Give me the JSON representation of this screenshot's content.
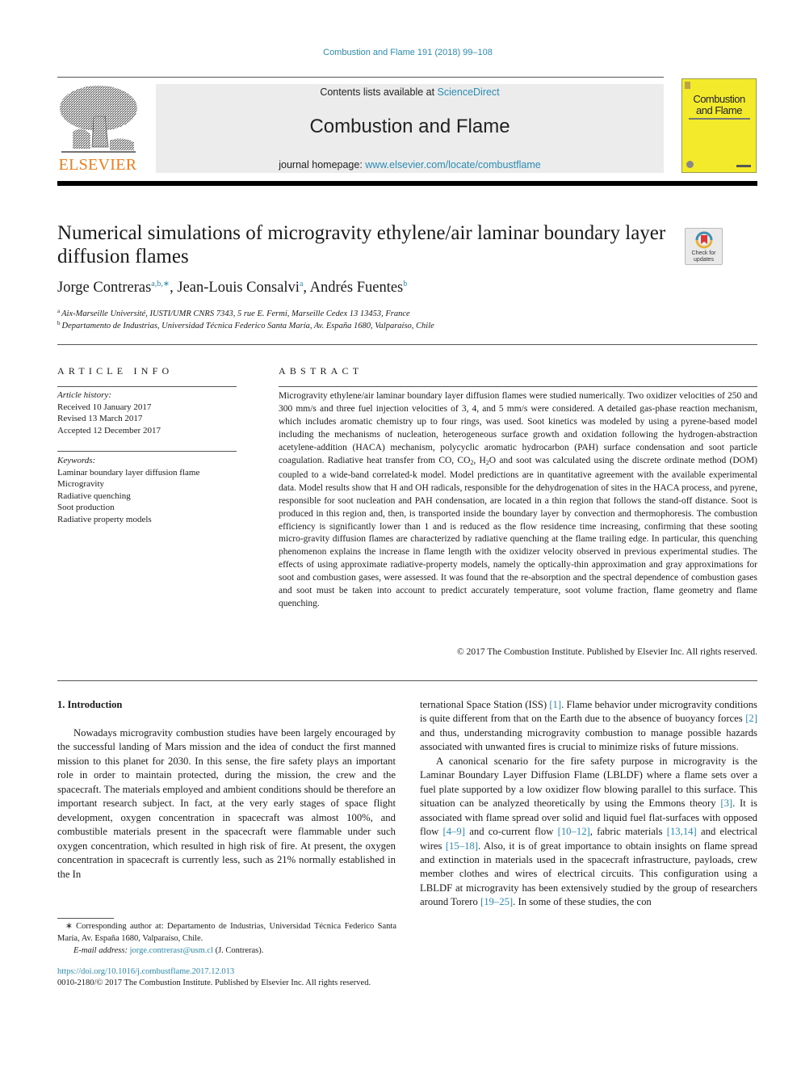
{
  "header": {
    "citation": "Combustion and Flame 191 (2018) 99–108",
    "contents_prefix": "Contents lists available at ",
    "contents_link": "ScienceDirect",
    "journal_name": "Combustion and Flame",
    "homepage_prefix": "journal homepage: ",
    "homepage_link": "www.elsevier.com/locate/combustflame",
    "publisher_logo_text": "ELSEVIER",
    "cover_title_line1": "Combustion",
    "cover_title_line2": "and Flame",
    "check_updates_line1": "Check for",
    "check_updates_line2": "updates"
  },
  "colors": {
    "link": "#2a8cb4",
    "elsevier_orange": "#f07d1b",
    "cover_yellow": "#f4ea2c",
    "banner_gray": "#ececec"
  },
  "article": {
    "title": "Numerical simulations of microgravity ethylene/air laminar boundary layer diffusion flames",
    "authors": [
      {
        "name": "Jorge Contreras",
        "marks": "a,b,∗"
      },
      {
        "name": "Jean-Louis Consalvi",
        "marks": "a"
      },
      {
        "name": "Andrés Fuentes",
        "marks": "b"
      }
    ],
    "affiliations": [
      {
        "mark": "a",
        "text": "Aix-Marseille Université, IUSTI/UMR CNRS 7343, 5 rue E. Fermi, Marseille Cedex 13 13453, France"
      },
      {
        "mark": "b",
        "text": "Departamento de Industrias, Universidad Técnica Federico Santa María, Av. España 1680, Valparaíso, Chile"
      }
    ]
  },
  "article_info": {
    "heading": "ARTICLE INFO",
    "history_label": "Article history:",
    "history": [
      "Received 10 January 2017",
      "Revised 13 March 2017",
      "Accepted 12 December 2017"
    ],
    "keywords_label": "Keywords:",
    "keywords": [
      "Laminar boundary layer diffusion flame",
      "Microgravity",
      "Radiative quenching",
      "Soot production",
      "Radiative property models"
    ]
  },
  "abstract": {
    "heading": "ABSTRACT",
    "part1": "Microgravity ethylene/air laminar boundary layer diffusion flames were studied numerically. Two oxidizer velocities of 250 and 300 mm/s and three fuel injection velocities of 3, 4, and 5 mm/s were considered. A detailed gas-phase reaction mechanism, which includes aromatic chemistry up to four rings, was used. Soot kinetics was modeled by using a pyrene-based model including the mechanisms of nucleation, het­erogeneous surface growth and oxidation following the hydrogen-abstraction acetylene-addition (HACA) mechanism, polycyclic aromatic hydrocarbon (PAH) surface condensation and soot particle coagulation. Radiative heat transfer from CO, CO",
    "sub1": "2",
    "part2": ", H",
    "sub2": "2",
    "part3": "O and soot was calculated using the discrete ordinate method (DOM) coupled to a wide-band correlated-k model. Model predictions are in quantitative agreement with the available experimental data. Model results show that H and OH radicals, responsible for the dehydro­genation of sites in the HACA process, and pyrene, responsible for soot nucleation and PAH condensation, are located in a thin region that follows the stand-off distance. Soot is produced in this region and, then, is transported inside the boundary layer by convection and thermophoresis. The combustion efficiency is significantly lower than 1 and is reduced as the flow residence time increasing, confirming that these sooting micro-gravity diffusion flames are characterized by radiative quenching at the flame trailing edge. In particular, this quenching phenomenon explains the increase in flame length with the oxidizer velocity observed in previous experimental studies. The effects of using approximate radiative-property models, namely the optically-thin approximation and gray approximations for soot and combustion gases, were assessed. It was found that the re-absorption and the spectral dependence of combustion gases and soot must be taken into account to predict accurately temperature, soot volume fraction, flame geometry and flame quenching.",
    "copyright": "© 2017 The Combustion Institute. Published by Elsevier Inc. All rights reserved."
  },
  "introduction": {
    "heading": "1. Introduction",
    "left_paragraph": "Nowadays microgravity combustion studies have been largely encouraged by the successful landing of Mars mission and the idea of conduct the first manned mission to this planet for 2030. In this sense, the fire safety plays an important role in order to maintain protected, during the mission, the crew and the spacecraft. The materials employed and ambient conditions should be therefore an important research subject. In fact, at the very early stages of space flight development, oxygen concentration in spacecraft was almost 100%, and combustible materials present in the spacecraft were flammable under such oxygen concentration, which resulted in high risk of fire. At present, the oxygen concentration in space­craft is currently less, such as 21% normally established in the In­",
    "right_p1": {
      "t1": "ternational Space Station (ISS) ",
      "r1": "[1]",
      "t2": ". Flame behavior under micro­gravity conditions is quite different from that on the Earth due to the absence of buoyancy forces ",
      "r2": "[2]",
      "t3": " and thus, understanding mi­crogravity combustion to manage possible hazards associated with unwanted fires is crucial to minimize risks of future missions."
    },
    "right_p2": {
      "t1": "A canonical scenario for the fire safety purpose in micrograv­ity is the Laminar Boundary Layer Diffusion Flame (LBLDF) where a flame sets over a fuel plate supported by a low oxidizer flow blowing parallel to this surface. This situation can be analyzed the­oretically by using the Emmons theory ",
      "r1": "[3]",
      "t2": ". It is associated with flame spread over solid and liquid fuel flat-surfaces with opposed flow ",
      "r2": "[4–9]",
      "t3": " and co-current flow ",
      "r3": "[10–12]",
      "t4": ", fabric materials ",
      "r4": "[13,14]",
      "t5": " and electrical wires ",
      "r5": "[15–18]",
      "t6": ". Also, it is of great importance to ob­tain insights on flame spread and extinction in materials used in the spacecraft infrastructure, payloads, crew member clothes and wires of electrical circuits. This configuration using a LBLDF at microgravity has been extensively studied by the group of re­searchers around Torero ",
      "r6": "[19–25]",
      "t7": ". In some of these studies, the con­"
    }
  },
  "footnote": {
    "mark": "∗",
    "corresponding": " Corresponding author at: Departamento de Industrias, Universidad Técnica Fed­erico Santa María, Av. España 1680, Valparaíso, Chile.",
    "email_label": "E-mail address:",
    "email": "jorge.contrerasr@usm.cl",
    "email_suffix": " (J. Contreras)."
  },
  "footer": {
    "doi": "https://doi.org/10.1016/j.combustflame.2017.12.013",
    "issn": "0010-2180/© 2017 The Combustion Institute. Published by Elsevier Inc. All rights reserved."
  }
}
